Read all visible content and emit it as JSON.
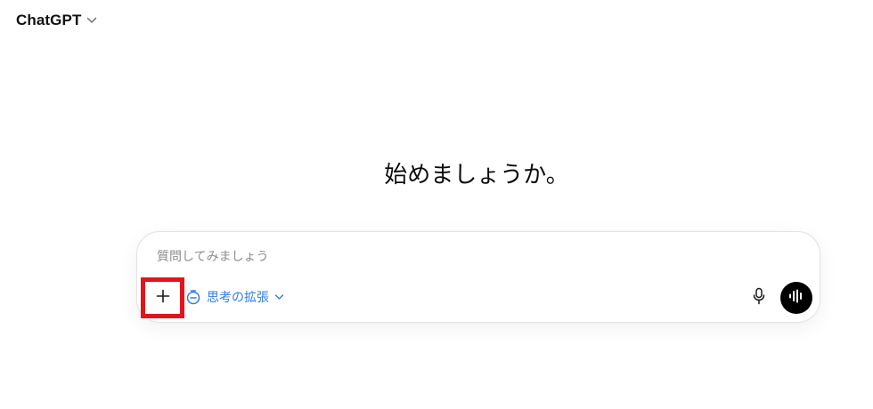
{
  "header": {
    "model_name": "ChatGPT",
    "model_menu_icon": "chevron-down-icon"
  },
  "main": {
    "greeting": "始めましょうか。"
  },
  "composer": {
    "placeholder": "質問してみましょう",
    "value": "",
    "attach_icon": "plus-icon",
    "tool_chip": {
      "label": "思考の拡張",
      "icon": "timer-icon",
      "menu_icon": "chevron-down-icon"
    },
    "mic_icon": "microphone-icon",
    "voice_icon": "voice-mode-waveform-icon"
  },
  "colors": {
    "background": "#ffffff",
    "text": "#0d0d0d",
    "accent_blue": "#2f7de1",
    "highlight_red": "#e3141c",
    "voice_button_bg": "#000000",
    "placeholder": "#8e8e8e"
  }
}
